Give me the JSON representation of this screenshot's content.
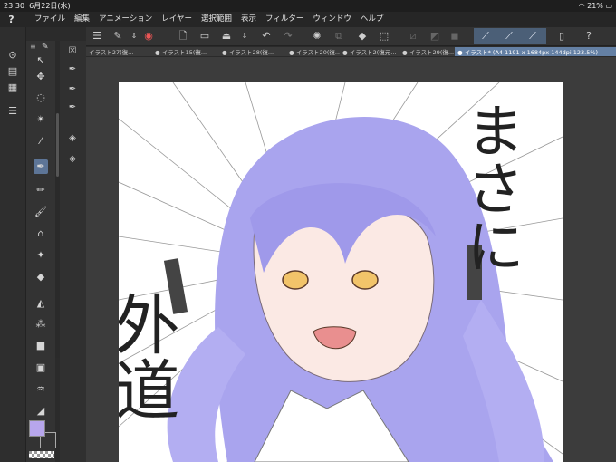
{
  "status": {
    "time": "23:30",
    "date": "6月22日(水)",
    "battery": "21%",
    "wifi_icon": "wifi-icon"
  },
  "menu": [
    "ファイル",
    "編集",
    "アニメーション",
    "レイヤー",
    "選択範囲",
    "表示",
    "フィルター",
    "ウィンドウ",
    "ヘルプ"
  ],
  "tabs": [
    {
      "label": "イラスト27(復..."
    },
    {
      "label": "● イラスト15(復..."
    },
    {
      "label": "● イラスト28(復..."
    },
    {
      "label": "● イラスト20(復..."
    },
    {
      "label": "● イラスト2(復元..."
    },
    {
      "label": "● イラスト29(復..."
    },
    {
      "label": "● イラスト* (A4 1191 x 1684px 144dpi 123.5%)",
      "active": true
    }
  ],
  "colors": {
    "main": "#b7a6ec",
    "sub": "#333333",
    "canvas": "#ffffff",
    "accent": "#6480a4"
  },
  "artwork": {
    "text_right": "まさに",
    "text_left": "外道"
  }
}
